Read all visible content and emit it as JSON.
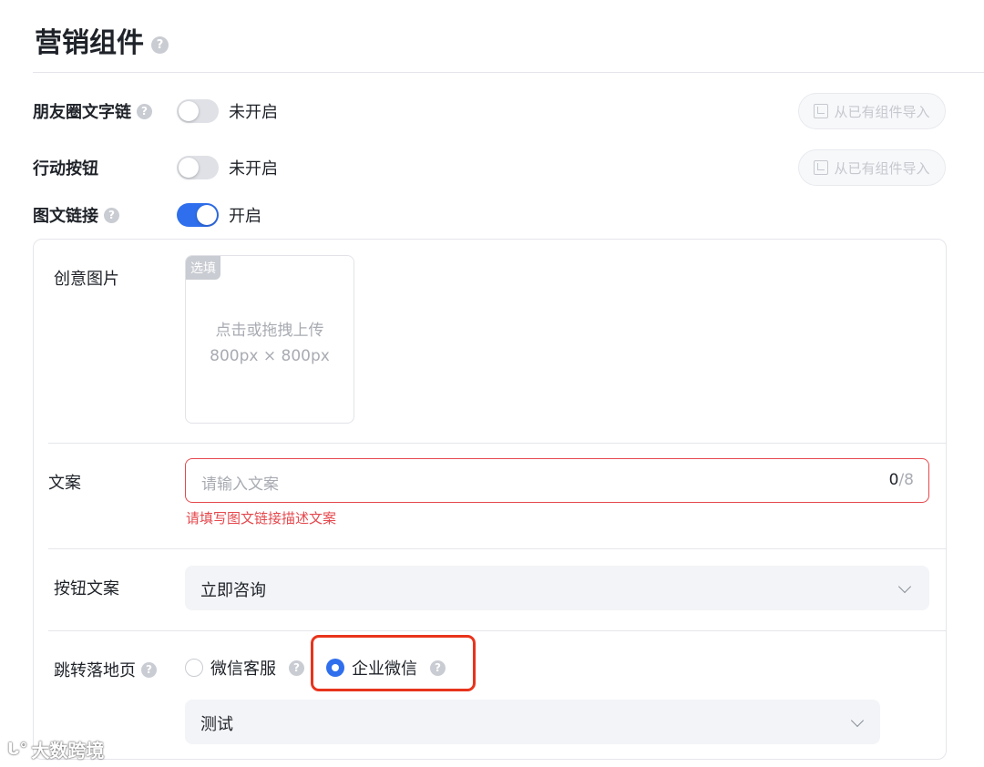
{
  "page": {
    "title": "营销组件"
  },
  "settings": {
    "moments_text_link": {
      "label": "朋友圈文字链",
      "status": "未开启",
      "enabled": false,
      "import_label": "从已有组件导入"
    },
    "action_button": {
      "label": "行动按钮",
      "status": "未开启",
      "enabled": false,
      "import_label": "从已有组件导入"
    },
    "image_text_link": {
      "label": "图文链接",
      "status": "开启",
      "enabled": true
    }
  },
  "panel": {
    "creative_image": {
      "label": "创意图片",
      "tag": "选填",
      "hint": "点击或拖拽上传",
      "size": "800px × 800px"
    },
    "copy": {
      "label": "文案",
      "placeholder": "请输入文案",
      "count_current": "0",
      "count_max": "/8",
      "error": "请填写图文链接描述文案"
    },
    "button_copy": {
      "label": "按钮文案",
      "value": "立即咨询"
    },
    "landing_page": {
      "label": "跳转落地页",
      "options": [
        "微信客服",
        "企业微信"
      ],
      "selected": "企业微信",
      "select_value": "测试"
    }
  },
  "watermark": {
    "text": "大数跨境"
  },
  "colors": {
    "accent": "#2f6fed",
    "error": "#e5484d",
    "highlight": "#e8341c"
  }
}
